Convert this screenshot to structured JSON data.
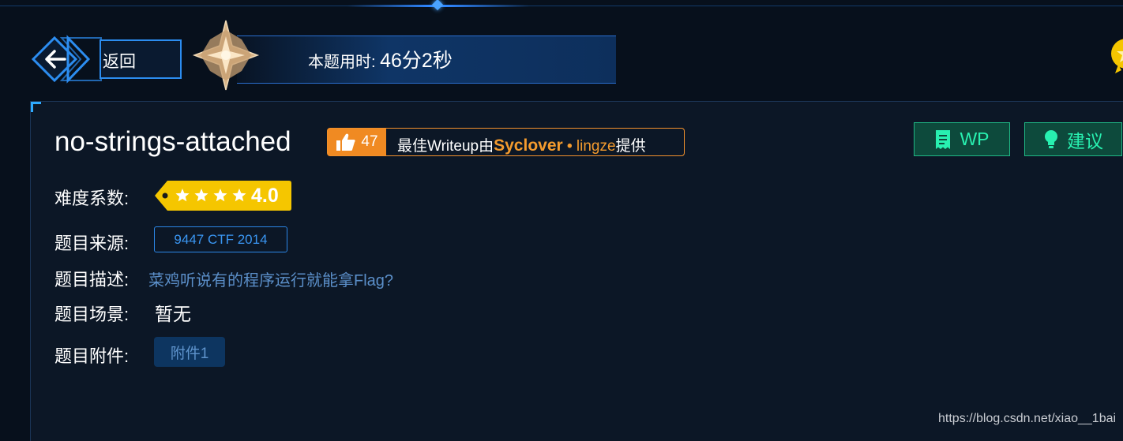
{
  "header": {
    "back_label": "返回",
    "timer_label": "本题用时: ",
    "timer_value": "46分2秒"
  },
  "challenge": {
    "title": "no-strings-attached",
    "likes": "47",
    "writeup_prefix": "最佳Writeup由",
    "writeup_team": "Syclover",
    "writeup_separator": " • ",
    "writeup_user": "lingze",
    "writeup_suffix": "提供",
    "wp_label": "WP",
    "suggest_label": "建议",
    "difficulty_label": "难度系数:",
    "difficulty_stars": 4,
    "difficulty_value": "4.0",
    "source_label": "题目来源:",
    "source_value": "9447 CTF 2014",
    "description_label": "题目描述:",
    "description_value": "菜鸡听说有的程序运行就能拿Flag?",
    "scene_label": "题目场景:",
    "scene_value": "暂无",
    "attachment_label": "题目附件:",
    "attachment_button": "附件1"
  },
  "watermark": "https://blog.csdn.net/xiao__1bai",
  "colors": {
    "background": "#07101c",
    "panel": "#0c1726",
    "accent_blue": "#2c8df0",
    "accent_orange": "#f08a22",
    "accent_green": "#28f0b0",
    "rating_yellow": "#f5c600"
  },
  "icons": {
    "back": "arrow-left-icon",
    "timer": "star-emblem-icon",
    "like": "thumbs-up-icon",
    "wp": "document-icon",
    "suggest": "lightbulb-icon",
    "rating": "star-icon"
  }
}
